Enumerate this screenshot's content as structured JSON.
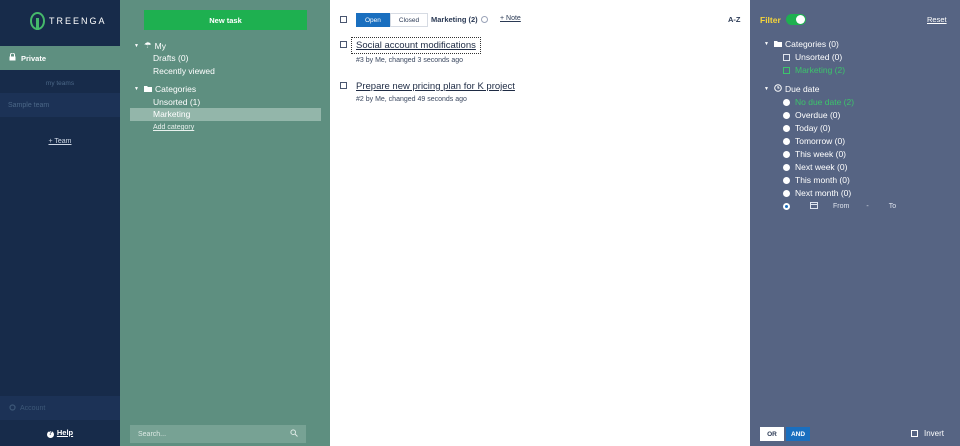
{
  "app": {
    "brand": "TREENGA"
  },
  "nav": {
    "private_label": "Private",
    "my_teams_label": "my teams",
    "sample_team": "Sample team",
    "add_team": "+ Team",
    "account": "Account",
    "help": "Help"
  },
  "categories_panel": {
    "new_task": "New task",
    "my_label": "My",
    "drafts": "Drafts (0)",
    "recently_viewed": "Recently viewed",
    "categories_label": "Categories",
    "unsorted": "Unsorted (1)",
    "marketing": "Marketing",
    "add_category": "Add category",
    "search_placeholder": "Search..."
  },
  "task_list": {
    "tabs": [
      "Open",
      "Closed"
    ],
    "title": "Marketing (2)",
    "note": "+ Note",
    "sort": "A-Z",
    "tasks": [
      {
        "title": "Social account modifications",
        "meta": "#3 by Me, changed 3 seconds ago"
      },
      {
        "title": "Prepare new pricing plan for K project",
        "meta": "#2 by Me, changed 49 seconds ago"
      }
    ]
  },
  "filter": {
    "title": "Filter",
    "reset": "Reset",
    "categories_head": "Categories (0)",
    "category_options": [
      "Unsorted (0)",
      "Marketing (2)"
    ],
    "due_head": "Due date",
    "due_options": [
      "No due date (2)",
      "Overdue (0)",
      "Today (0)",
      "Tomorrow (0)",
      "This week (0)",
      "Next week (0)",
      "This month (0)",
      "Next month (0)"
    ],
    "from": "From",
    "dash": "-",
    "to": "To",
    "or": "OR",
    "and": "AND",
    "invert": "Invert"
  },
  "colors": {
    "accent_green": "#1eb050",
    "filter_yellow": "#f6d53a",
    "link_blue": "#1a6fbf"
  }
}
